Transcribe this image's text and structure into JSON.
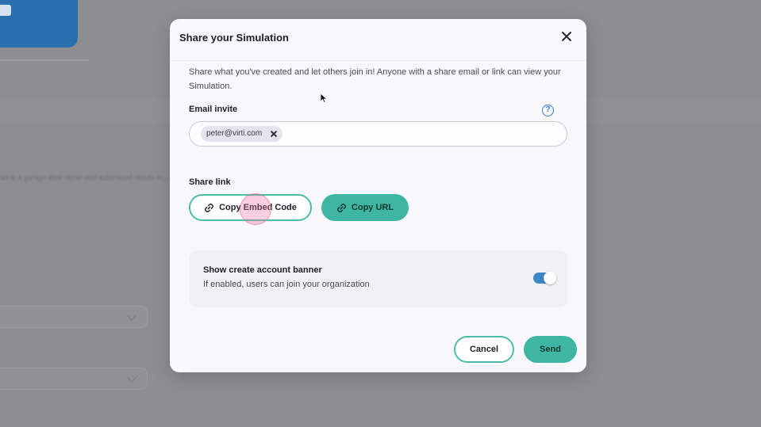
{
  "modal": {
    "title": "Share your Simulation",
    "description": "Share what you've created and let others join in! Anyone with a share email or link can view your Simulation.",
    "email_label": "Email invite",
    "help_symbol": "?",
    "email_chips": [
      "peter@virti.com"
    ],
    "share_label": "Share link",
    "copy_embed_label": "Copy Embed Code",
    "copy_url_label": "Copy URL",
    "banner_title": "Show create account banner",
    "banner_subtitle": "If enabled, users can join your organization",
    "banner_toggle_on": true,
    "cancel_label": "Cancel",
    "send_label": "Send"
  },
  "icons": {
    "close": "close-icon",
    "help": "help-icon",
    "chip_remove": "remove-chip-icon",
    "link": "link-icon"
  },
  "colors": {
    "accent": "#3fb6a3",
    "accent_border": "#4cbdab",
    "toggle": "#3d86c8",
    "help": "#3a76c8",
    "click_marker": "#e876a2"
  },
  "background_page": {
    "blurred_text": "ad to a garage door repair and automated results in..."
  }
}
